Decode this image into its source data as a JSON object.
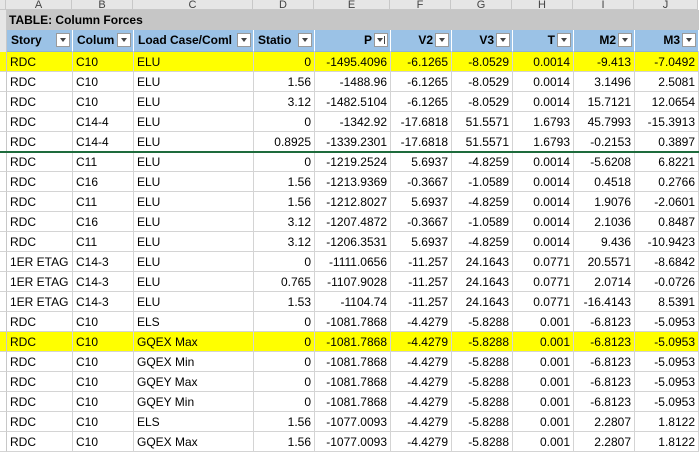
{
  "column_letters": [
    "A",
    "B",
    "C",
    "D",
    "E",
    "F",
    "G",
    "H",
    "I",
    "J"
  ],
  "table_title": "TABLE:  Column Forces",
  "headers": [
    "Story",
    "Colum",
    "Load Case/Coml",
    "Statio",
    "P",
    "V2",
    "V3",
    "T",
    "M2",
    "M3"
  ],
  "rows": [
    {
      "highlight": true,
      "cells": [
        "RDC",
        "C10",
        "ELU",
        "0",
        "-1495.4096",
        "-6.1265",
        "-8.0529",
        "0.0014",
        "-9.413",
        "-7.0492"
      ]
    },
    {
      "highlight": false,
      "cells": [
        "RDC",
        "C10",
        "ELU",
        "1.56",
        "-1488.96",
        "-6.1265",
        "-8.0529",
        "0.0014",
        "3.1496",
        "2.5081"
      ]
    },
    {
      "highlight": false,
      "cells": [
        "RDC",
        "C10",
        "ELU",
        "3.12",
        "-1482.5104",
        "-6.1265",
        "-8.0529",
        "0.0014",
        "15.7121",
        "12.0654"
      ]
    },
    {
      "highlight": false,
      "cells": [
        "RDC",
        "C14-4",
        "ELU",
        "0",
        "-1342.92",
        "-17.6818",
        "51.5571",
        "1.6793",
        "45.7993",
        "-15.3913"
      ]
    },
    {
      "highlight": false,
      "cells": [
        "RDC",
        "C14-4",
        "ELU",
        "0.8925",
        "-1339.2301",
        "-17.6818",
        "51.5571",
        "1.6793",
        "-0.2153",
        "0.3897"
      ]
    },
    {
      "highlight": false,
      "cells": [
        "RDC",
        "C11",
        "ELU",
        "0",
        "-1219.2524",
        "5.6937",
        "-4.8259",
        "0.0014",
        "-5.6208",
        "6.8221"
      ]
    },
    {
      "highlight": false,
      "cells": [
        "RDC",
        "C16",
        "ELU",
        "1.56",
        "-1213.9369",
        "-0.3667",
        "-1.0589",
        "0.0014",
        "0.4518",
        "0.2766"
      ]
    },
    {
      "highlight": false,
      "cells": [
        "RDC",
        "C11",
        "ELU",
        "1.56",
        "-1212.8027",
        "5.6937",
        "-4.8259",
        "0.0014",
        "1.9076",
        "-2.0601"
      ]
    },
    {
      "highlight": false,
      "cells": [
        "RDC",
        "C16",
        "ELU",
        "3.12",
        "-1207.4872",
        "-0.3667",
        "-1.0589",
        "0.0014",
        "2.1036",
        "0.8487"
      ]
    },
    {
      "highlight": false,
      "cells": [
        "RDC",
        "C11",
        "ELU",
        "3.12",
        "-1206.3531",
        "5.6937",
        "-4.8259",
        "0.0014",
        "9.436",
        "-10.9423"
      ]
    },
    {
      "highlight": false,
      "cells": [
        "1ER ETAG",
        "C14-3",
        "ELU",
        "0",
        "-1111.0656",
        "-11.257",
        "24.1643",
        "0.0771",
        "20.5571",
        "-8.6842"
      ]
    },
    {
      "highlight": false,
      "cells": [
        "1ER ETAG",
        "C14-3",
        "ELU",
        "0.765",
        "-1107.9028",
        "-11.257",
        "24.1643",
        "0.0771",
        "2.0714",
        "-0.0726"
      ]
    },
    {
      "highlight": false,
      "cells": [
        "1ER ETAG",
        "C14-3",
        "ELU",
        "1.53",
        "-1104.74",
        "-11.257",
        "24.1643",
        "0.0771",
        "-16.4143",
        "8.5391"
      ]
    },
    {
      "highlight": false,
      "cells": [
        "RDC",
        "C10",
        "ELS",
        "0",
        "-1081.7868",
        "-4.4279",
        "-5.8288",
        "0.001",
        "-6.8123",
        "-5.0953"
      ]
    },
    {
      "highlight": true,
      "cells": [
        "RDC",
        "C10",
        "GQEX Max",
        "0",
        "-1081.7868",
        "-4.4279",
        "-5.8288",
        "0.001",
        "-6.8123",
        "-5.0953"
      ]
    },
    {
      "highlight": false,
      "cells": [
        "RDC",
        "C10",
        "GQEX Min",
        "0",
        "-1081.7868",
        "-4.4279",
        "-5.8288",
        "0.001",
        "-6.8123",
        "-5.0953"
      ]
    },
    {
      "highlight": false,
      "cells": [
        "RDC",
        "C10",
        "GQEY Max",
        "0",
        "-1081.7868",
        "-4.4279",
        "-5.8288",
        "0.001",
        "-6.8123",
        "-5.0953"
      ]
    },
    {
      "highlight": false,
      "cells": [
        "RDC",
        "C10",
        "GQEY Min",
        "0",
        "-1081.7868",
        "-4.4279",
        "-5.8288",
        "0.001",
        "-6.8123",
        "-5.0953"
      ]
    },
    {
      "highlight": false,
      "cells": [
        "RDC",
        "C10",
        "ELS",
        "1.56",
        "-1077.0093",
        "-4.4279",
        "-5.8288",
        "0.001",
        "2.2807",
        "1.8122"
      ]
    },
    {
      "highlight": false,
      "cells": [
        "RDC",
        "C10",
        "GQEX Max",
        "1.56",
        "-1077.0093",
        "-4.4279",
        "-5.8288",
        "0.001",
        "2.2807",
        "1.8122"
      ]
    }
  ],
  "colors": {
    "highlight": "#ffff00",
    "header_fill": "#9bc2e6",
    "title_fill": "#c6c6c6",
    "divider": "#1e6b3c"
  }
}
